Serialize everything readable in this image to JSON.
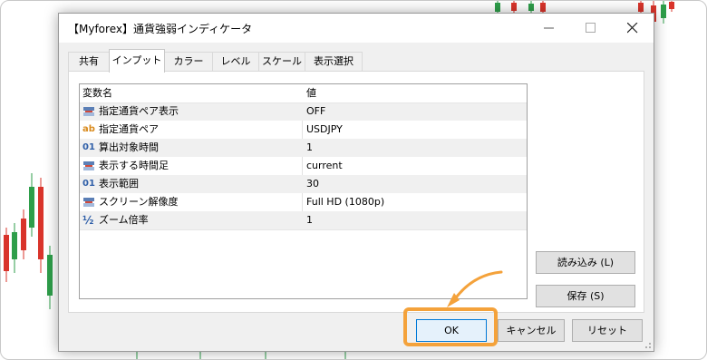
{
  "window": {
    "title": "【Myforex】通貨強弱インディケータ"
  },
  "tabs": [
    "共有",
    "インプット",
    "カラー",
    "レベル",
    "スケール",
    "表示選択"
  ],
  "active_tab": "インプット",
  "table": {
    "headers": [
      "変数名",
      "値"
    ],
    "rows": [
      {
        "icon": "enum-icon",
        "name": "指定通貨ペア表示",
        "value": "OFF"
      },
      {
        "icon": "string-ab-icon",
        "icon_text": "ab",
        "name": "指定通貨ペア",
        "value": "USDJPY"
      },
      {
        "icon": "integer-01-icon",
        "icon_text": "01",
        "name": "算出対象時間",
        "value": "1"
      },
      {
        "icon": "enum-icon",
        "name": "表示する時間足",
        "value": "current"
      },
      {
        "icon": "integer-01-icon",
        "icon_text": "01",
        "name": "表示範囲",
        "value": "30"
      },
      {
        "icon": "enum-icon",
        "name": "スクリーン解像度",
        "value": "Full HD (1080p)"
      },
      {
        "icon": "fraction-icon",
        "icon_text": "½",
        "name": "ズーム倍率",
        "value": "1"
      }
    ]
  },
  "buttons": {
    "load": "読み込み (L)",
    "save": "保存 (S)",
    "ok": "OK",
    "cancel": "キャンセル",
    "reset": "リセット"
  },
  "colors": {
    "highlight": "#f4a23b",
    "candle_up": "#2e9e4a",
    "candle_down": "#d9342b",
    "enum_icon": "#5b7fb6",
    "ab_icon": "#d98a1c",
    "int_icon": "#2f5fa8"
  }
}
